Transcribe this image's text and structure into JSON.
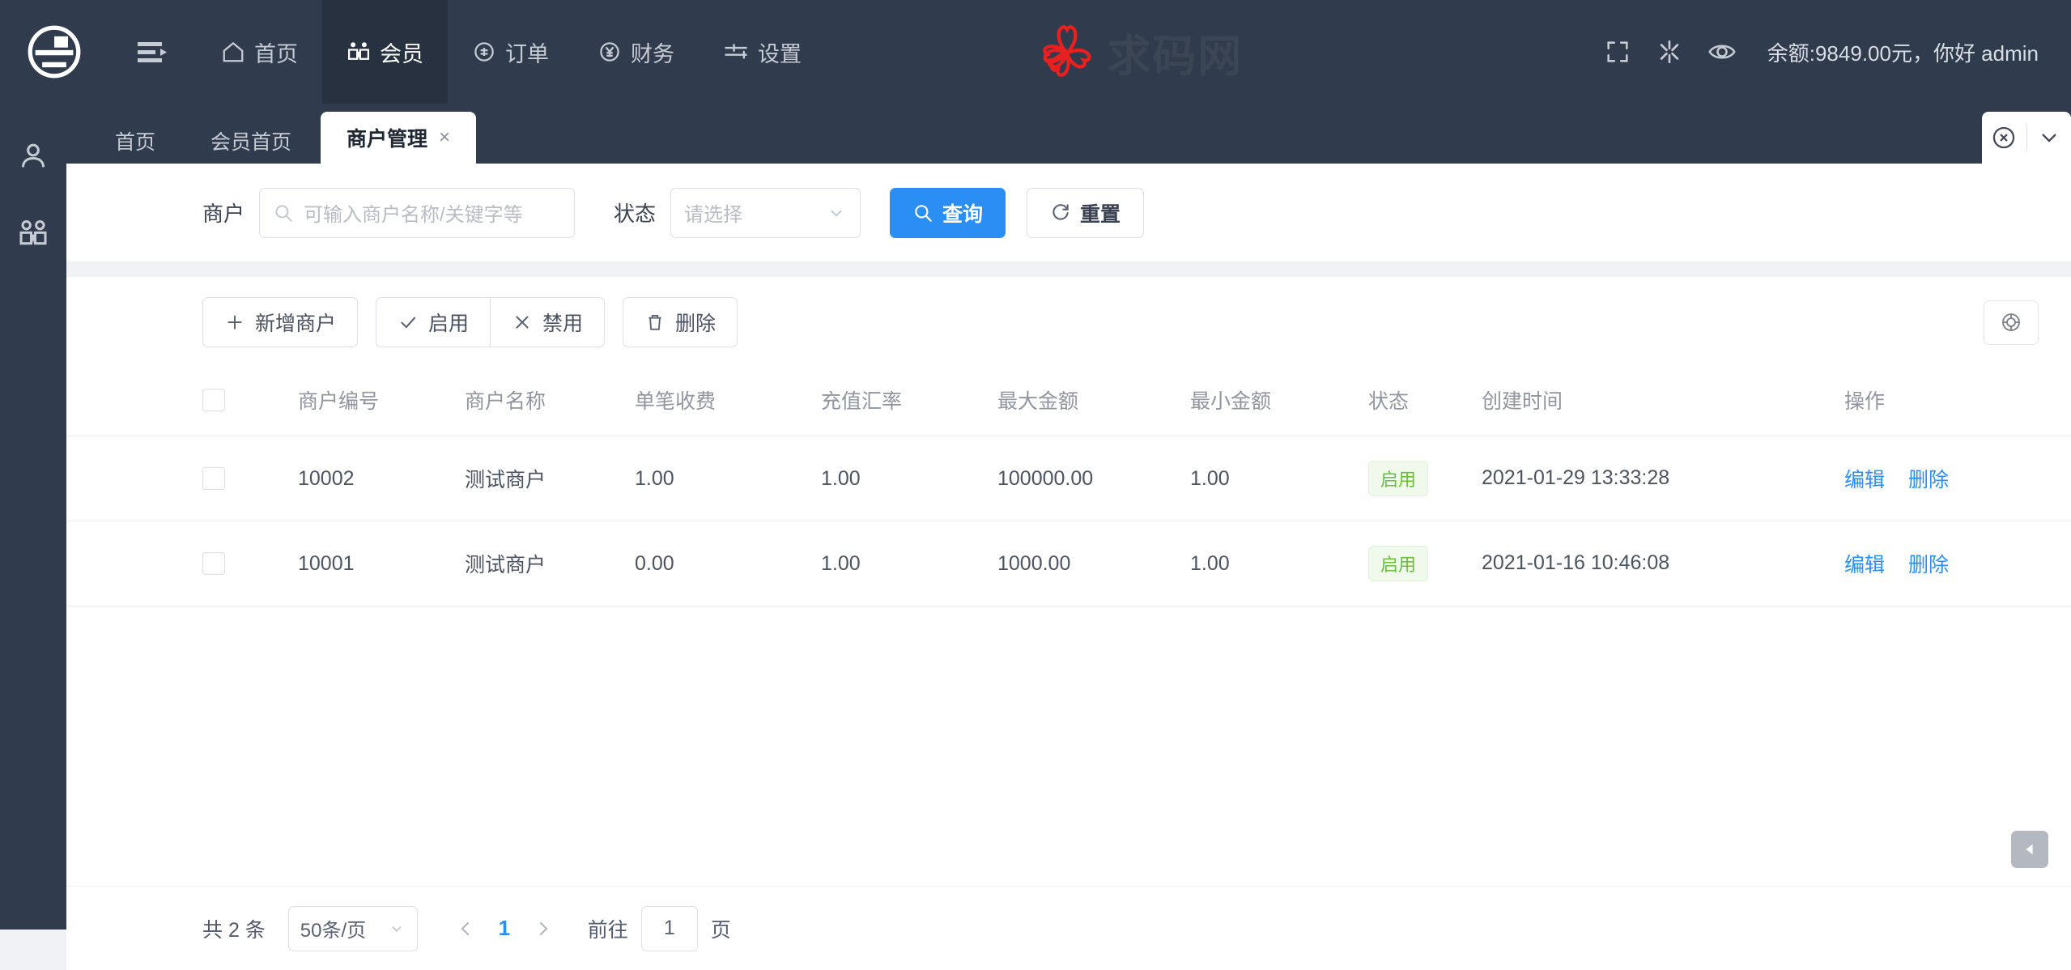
{
  "topnav": {
    "logo_icon": "company-logo-icon",
    "menu_toggle_icon": "hamburger-menu-icon",
    "items": [
      {
        "label": "首页",
        "icon": "home-icon",
        "active": false
      },
      {
        "label": "会员",
        "icon": "members-icon",
        "active": true
      },
      {
        "label": "订单",
        "icon": "order-icon",
        "active": false
      },
      {
        "label": "财务",
        "icon": "finance-yuan-icon",
        "active": false
      },
      {
        "label": "设置",
        "icon": "settings-sliders-icon",
        "active": false
      }
    ],
    "brand_watermark": "求码网",
    "brand_flower_icon": "red-flower-logo-icon",
    "right_icons": [
      "fullscreen-icon",
      "theme-icon",
      "eye-icon"
    ],
    "user_text": "余额:9849.00元，你好 admin"
  },
  "leftrail": {
    "items": [
      {
        "icon": "user-profile-icon",
        "name": "sidebar-item-user"
      },
      {
        "icon": "members-group-icon",
        "name": "sidebar-item-members"
      }
    ]
  },
  "tabs": {
    "items": [
      {
        "label": "首页",
        "closable": false,
        "active": false
      },
      {
        "label": "会员首页",
        "closable": false,
        "active": false
      },
      {
        "label": "商户管理",
        "closable": true,
        "active": true
      }
    ],
    "close_glyph": "×",
    "controls": {
      "close_all_icon": "close-circle-icon",
      "dropdown_icon": "chevron-down-icon"
    }
  },
  "filter": {
    "merchant_label": "商户",
    "merchant_placeholder": "可输入商户名称/关键字等",
    "merchant_value": "",
    "search_icon": "search-icon",
    "status_label": "状态",
    "status_value": "请选择",
    "status_caret_icon": "chevron-down-icon",
    "query_button": "查询",
    "query_icon": "search-icon",
    "reset_button": "重置",
    "reset_icon": "refresh-icon"
  },
  "toolbar": {
    "add_label": "新增商户",
    "add_icon": "plus-icon",
    "enable_label": "启用",
    "enable_icon": "check-icon",
    "disable_label": "禁用",
    "disable_icon": "cross-icon",
    "delete_label": "删除",
    "delete_icon": "trash-icon",
    "settings_icon": "table-settings-icon"
  },
  "table": {
    "select_all_checked": false,
    "columns": [
      "商户编号",
      "商户名称",
      "单笔收费",
      "充值汇率",
      "最大金额",
      "最小金额",
      "状态",
      "创建时间",
      "操作"
    ],
    "rows": [
      {
        "checked": false,
        "merchant_no": "10002",
        "merchant_name": "测试商户",
        "single_fee": "1.00",
        "rate": "1.00",
        "max_amount": "100000.00",
        "min_amount": "1.00",
        "status": "启用",
        "created_at": "2021-01-29 13:33:28",
        "edit_label": "编辑",
        "delete_label": "删除"
      },
      {
        "checked": false,
        "merchant_no": "10001",
        "merchant_name": "测试商户",
        "single_fee": "0.00",
        "rate": "1.00",
        "max_amount": "1000.00",
        "min_amount": "1.00",
        "status": "启用",
        "created_at": "2021-01-16 10:46:08",
        "edit_label": "编辑",
        "delete_label": "删除"
      }
    ],
    "collapse_icon": "triangle-left-icon"
  },
  "pagination": {
    "total_text": "共 2 条",
    "page_size": "50条/页",
    "page_size_caret_icon": "chevron-down-icon",
    "prev_icon": "chevron-left-icon",
    "next_icon": "chevron-right-icon",
    "current_page": "1",
    "goto_label": "前往",
    "goto_value": "1",
    "page_unit": "页"
  },
  "colors": {
    "nav_bg": "#303b4d",
    "nav_active_bg": "#28313f",
    "primary": "#2a8ef5",
    "success": "#67c23a",
    "brand_red": "#e8201f",
    "page_bg": "#f0f2f5"
  }
}
